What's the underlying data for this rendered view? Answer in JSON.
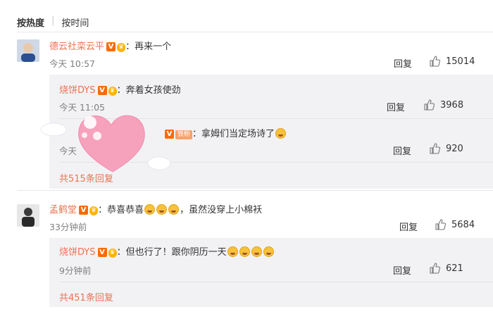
{
  "sort": {
    "hot": "按热度",
    "time": "按时间"
  },
  "comments": [
    {
      "user": "德云社栾云平",
      "text": "：再来一个",
      "time": "今天 10:57",
      "reply": "回复",
      "likes": "15014",
      "subs": [
        {
          "user": "烧饼DYS",
          "text": "：奔着女孩使劲",
          "time": "今天 11:05",
          "reply": "回复",
          "likes": "3968"
        },
        {
          "user": "",
          "fan_badge": "铁粉",
          "text": "：拿姆们当定场诗了",
          "time": "今天",
          "reply": "回复",
          "likes": "920"
        }
      ],
      "more": "共515条回复"
    },
    {
      "user": "孟鹤堂",
      "text_a": "：恭喜恭喜",
      "text_b": "，虽然没穿上小棉袄",
      "time": "33分钟前",
      "reply": "回复",
      "likes": "5684",
      "subs": [
        {
          "user": "烧饼DYS",
          "text": "：但也行了！跟你阴历一天",
          "time": "9分钟前",
          "reply": "回复",
          "likes": "621"
        }
      ],
      "more": "共451条回复"
    }
  ],
  "colors": {
    "name": "#eb7350",
    "vip": "#ff6a00",
    "heart": "#f7a2bd",
    "sub_bg": "#f2f2f5"
  },
  "icons": {
    "like": "thumbs-up-icon",
    "emoji": "crying-laughing-emoji-icon",
    "vip": "v-badge-icon"
  }
}
